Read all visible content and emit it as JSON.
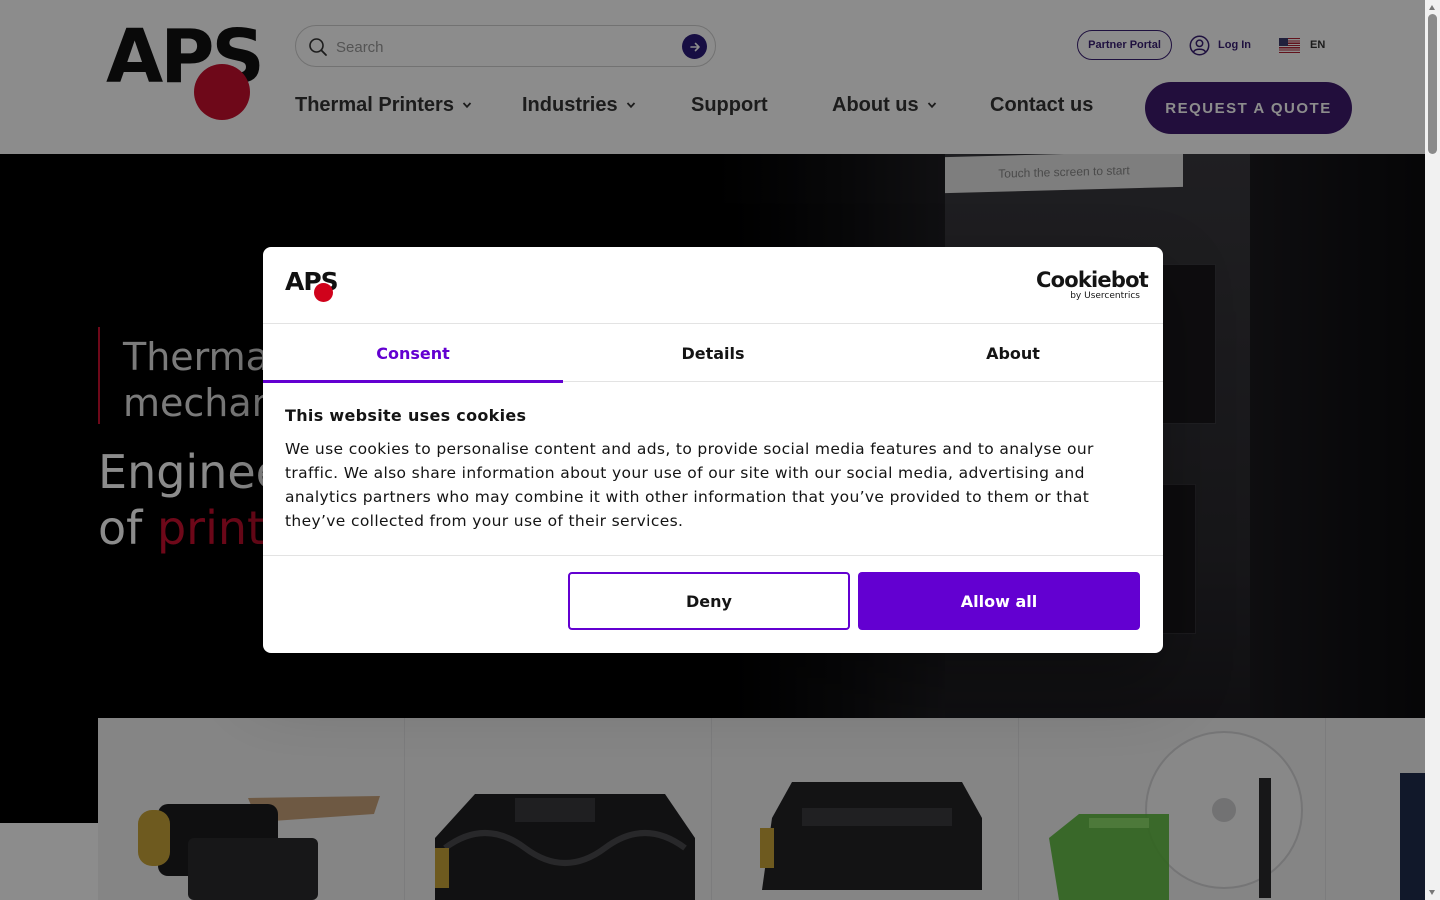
{
  "header": {
    "logo_text": "APS",
    "search": {
      "placeholder": "Search"
    },
    "partner_portal": "Partner Portal",
    "login": "Log In",
    "language": "EN",
    "nav": [
      {
        "label": "Thermal Printers",
        "has_dropdown": true
      },
      {
        "label": "Industries",
        "has_dropdown": true
      },
      {
        "label": "Support",
        "has_dropdown": false
      },
      {
        "label": "About us",
        "has_dropdown": true
      },
      {
        "label": "Contact us",
        "has_dropdown": false
      }
    ],
    "quote_button": "REQUEST A QUOTE"
  },
  "hero": {
    "subtitle_line1": "Thermal",
    "subtitle_line2": "mechan",
    "title_line1": "Enginee",
    "title_line2_plain": "of ",
    "title_line2_accent": "printi",
    "kiosk_screen_text": "Touch the screen to start"
  },
  "cookie_dialog": {
    "logo_text": "APS",
    "brand_name": "Cookiebot",
    "brand_by": "by Usercentrics",
    "tabs": [
      {
        "label": "Consent",
        "active": true
      },
      {
        "label": "Details",
        "active": false
      },
      {
        "label": "About",
        "active": false
      }
    ],
    "heading": "This website uses cookies",
    "text": "We use cookies to personalise content and ads, to provide social media features and to analyse our traffic. We also share information about your use of our site with our social media, advertising and analytics partners who may combine it with other information that you’ve provided to them or that they’ve collected from your use of their services.",
    "deny_button": "Deny",
    "allow_button": "Allow all"
  },
  "colors": {
    "brand_red": "#c8102e",
    "brand_purple": "#3e1b6e",
    "cookiebot_purple": "#6300d1"
  }
}
